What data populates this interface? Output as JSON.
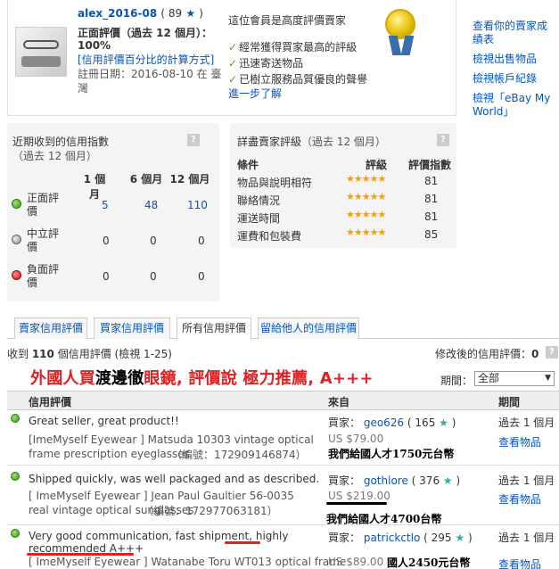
{
  "seller": {
    "name": "alex_2016-08",
    "score": "( 89",
    "score_close": ")",
    "star": "★",
    "pos_label": "正面評價（過去 12 個月）：",
    "pos_value": "100%",
    "calc_link": "[信用評價百分比的計算方式]",
    "reg_label": "註冊日期：",
    "reg_value": "2016-08-10 在 臺",
    "reg_cont": "灣"
  },
  "top_rated": {
    "title": "這位會員是高度評價賣家",
    "items": [
      "經常獲得買家最高的評級",
      "迅速寄送物品",
      "已樹立服務品質優良的聲譽"
    ],
    "more": "進一步了解",
    "check": "✓"
  },
  "side_links": [
    "查看你的賣家成績表",
    "檢視出售物品",
    "檢視帳戶紀錄",
    "檢視「eBay My World」"
  ],
  "recent": {
    "title": "近期收到的信用指數",
    "subtitle": "（過去 12 個月）",
    "q": "?",
    "cols": [
      "1 個月",
      "6 個月",
      "12 個月"
    ],
    "rows": [
      {
        "label": "正面評價",
        "vals": [
          "5",
          "48",
          "110"
        ],
        "color": "green"
      },
      {
        "label": "中立評價",
        "vals": [
          "0",
          "0",
          "0"
        ],
        "color": "gray"
      },
      {
        "label": "負面評價",
        "vals": [
          "0",
          "0",
          "0"
        ],
        "color": "red"
      }
    ]
  },
  "dsr": {
    "title": "詳盡賣家評級",
    "subtitle": "（過去 12 個月）",
    "q": "?",
    "cols": [
      "條件",
      "評級",
      "評價指數"
    ],
    "rows": [
      {
        "label": "物品與說明相符",
        "stars": "★★★★★",
        "count": "81"
      },
      {
        "label": "聯絡情況",
        "stars": "★★★★★",
        "count": "81"
      },
      {
        "label": "運送時間",
        "stars": "★★★★★",
        "count": "81"
      },
      {
        "label": "運費和包裝費",
        "stars": "★★★★★",
        "count": "85"
      }
    ]
  },
  "tabs": [
    "賣家信用評價",
    "買家信用評價",
    "所有信用評價",
    "留給他人的信用評價"
  ],
  "summary": {
    "received_pre": "收到 ",
    "received_num": "110",
    "received_post": " 個信用評價 (檢視 1-25)",
    "revised": "修改後的信用評價：",
    "revised_num": "0",
    "q": "?"
  },
  "headline": {
    "p1": "外國人買",
    "p2": "渡邊徹",
    "p3": "眼鏡, 評價說 極力推薦, A+++"
  },
  "period": {
    "label": "期間：",
    "value": "全部"
  },
  "table_head": [
    "信用評價",
    "來自",
    "期間"
  ],
  "rows": [
    {
      "comment": "Great seller, great product!!",
      "item": "[ImeMyself Eyewear ] Matsuda 10303 vintage optical frame prescription eyeglasses",
      "item_no": "（編號：172909146874）",
      "buyer_label": "買家：",
      "buyer": "geo626",
      "buyer_score": "( 165",
      "price": "US $79.00",
      "note": "我們給國人才1750元台幣",
      "period": "過去 1 個月",
      "view": "查看物品"
    },
    {
      "comment": "Shipped quickly, was well packaged and as described.",
      "item": "[ ImeMyself Eyewear ] Jean Paul Gaultier 56-0035 real vintage optical sunglasses",
      "item_no": "（編號：172977063181）",
      "buyer_label": "買家：",
      "buyer": "gothlore",
      "buyer_score": "( 376",
      "price": "US $219.00",
      "note": "我們給國人才4700台幣",
      "period": "過去 1 個月",
      "view": "查看物品"
    },
    {
      "comment1": "Very good communication, fast shipment, ",
      "comment_hl": "highly",
      "comment2": "recommended A+++",
      "item_pre": "[ ImeMyself Eyewear ] ",
      "item_hl": "Watanabe Toru WT013",
      "item_post": " optical frame",
      "buyer_label": "買家：",
      "buyer": "patrickctlo",
      "buyer_score": "( 295",
      "price": "US $89.00",
      "note": "國人2450元台幣",
      "period": "過去 1 個月",
      "view": "查看物品"
    }
  ],
  "colors": {
    "link": "#0654ba",
    "headline_red": "#e02020",
    "green": "#3a9a16"
  }
}
